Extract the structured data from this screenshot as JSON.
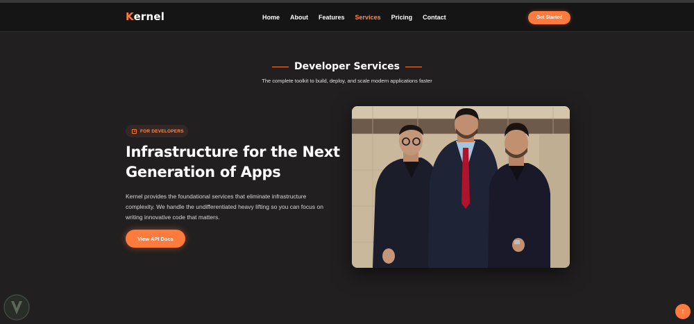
{
  "brand": {
    "first_letter": "K",
    "rest": "ernel"
  },
  "nav": {
    "links": [
      "Home",
      "About",
      "Features",
      "Services",
      "Pricing",
      "Contact"
    ],
    "active": "Services",
    "cta_label": "Get Started"
  },
  "section": {
    "title": "Developer Services",
    "subtitle": "The complete toolkit to build, deploy, and scale modern applications faster"
  },
  "hero": {
    "badge": "FOR DEVELOPERS",
    "title_line1": "Infrastructure for the Next",
    "title_line2": "Generation of Apps",
    "description": "Kernel provides the foundational services that eliminate infrastructure complexity. We handle the undifferentiated heavy lifting so you can focus on writing innovative code that matters.",
    "button_label": "View API Docs"
  },
  "icons": {
    "badge": "code-icon",
    "scroll_top": "arrow-up-icon",
    "watermark": "shield-logo-icon"
  },
  "colors": {
    "accent": "#ff7a3d",
    "background": "#211f1f",
    "navbar": "#161515"
  }
}
